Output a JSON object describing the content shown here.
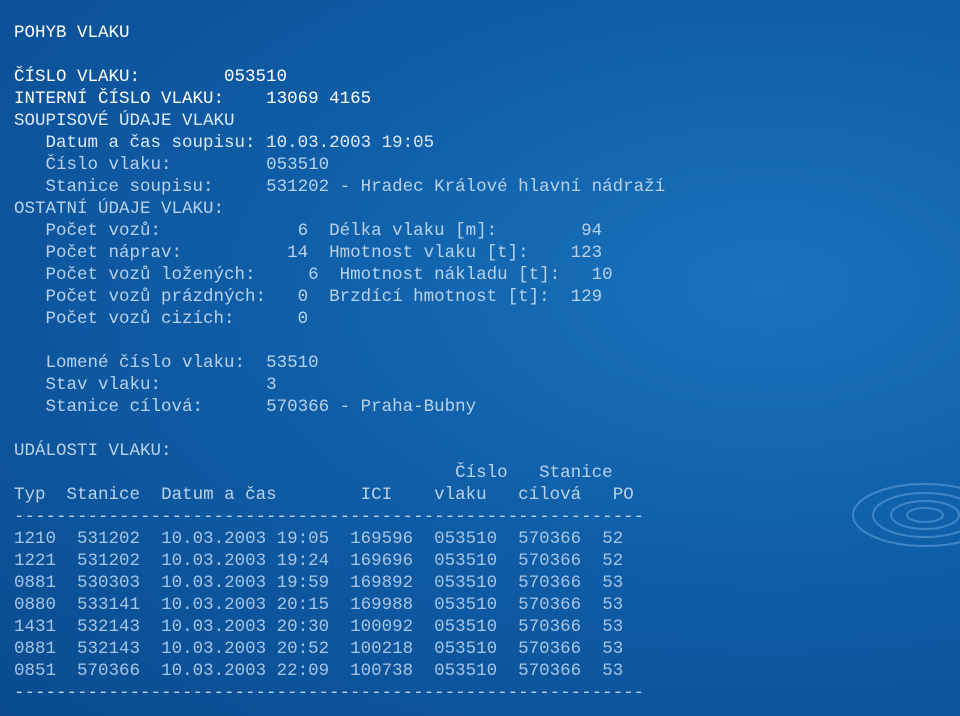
{
  "report": {
    "title": "POHYB VLAKU",
    "cislo_vlaku_label": "ČÍSLO VLAKU:",
    "cislo_vlaku": "053510",
    "interni_label": "INTERNÍ ČÍSLO VLAKU:",
    "interni": "13069 4165",
    "soupis_section": "SOUPISOVÉ ÚDAJE VLAKU",
    "datum_cas_label": "Datum a čas soupisu:",
    "datum_cas": "10.03.2003 19:05",
    "cislo_label": "Číslo vlaku:",
    "cislo": "053510",
    "stanice_soupisu_label": "Stanice soupisu:",
    "stanice_soupisu": "531202 - Hradec Králové hlavní nádraží",
    "ostatni_section": "OSTATNÍ ÚDAJE VLAKU:",
    "pocet_vozu_label": "Počet vozů:",
    "pocet_vozu": "6",
    "delka_label": "Délka vlaku [m]:",
    "delka": "94",
    "pocet_naprav_label": "Počet náprav:",
    "pocet_naprav": "14",
    "hmotnost_label": "Hmotnost vlaku [t]:",
    "hmotnost": "123",
    "lozenych_label": "Počet vozů ložených:",
    "lozenych": "6",
    "naklad_label": "Hmotnost nákladu [t]:",
    "naklad": "10",
    "prazdnych_label": "Počet vozů prázdných:",
    "prazdnych": "0",
    "brzdici_label": "Brzdící hmotnost [t]:",
    "brzdici": "129",
    "cizich_label": "Počet vozů cizích:",
    "cizich": "0",
    "lomene_label": "Lomené číslo vlaku:",
    "lomene": "53510",
    "stav_label": "Stav vlaku:",
    "stav": "3",
    "cilova_label": "Stanice cílová:",
    "cilova": "570366 - Praha-Bubny"
  },
  "events": {
    "title": "UDÁLOSTI VLAKU:",
    "header_top": {
      "cislo": "Číslo",
      "stanice": "Stanice"
    },
    "headers": {
      "typ": "Typ",
      "stanice": "Stanice",
      "datum": "Datum a čas",
      "ici": "ICI",
      "vlaku": "vlaku",
      "cilova": "cílová",
      "po": "PO"
    },
    "separator": "------------------------------------------------------------",
    "rows": [
      {
        "typ": "1210",
        "stanice": "531202",
        "datum": "10.03.2003 19:05",
        "ici": "169596",
        "vlak": "053510",
        "cil": "570366",
        "po": "52"
      },
      {
        "typ": "1221",
        "stanice": "531202",
        "datum": "10.03.2003 19:24",
        "ici": "169696",
        "vlak": "053510",
        "cil": "570366",
        "po": "52"
      },
      {
        "typ": "0881",
        "stanice": "530303",
        "datum": "10.03.2003 19:59",
        "ici": "169892",
        "vlak": "053510",
        "cil": "570366",
        "po": "53"
      },
      {
        "typ": "0880",
        "stanice": "533141",
        "datum": "10.03.2003 20:15",
        "ici": "169988",
        "vlak": "053510",
        "cil": "570366",
        "po": "53"
      },
      {
        "typ": "1431",
        "stanice": "532143",
        "datum": "10.03.2003 20:30",
        "ici": "100092",
        "vlak": "053510",
        "cil": "570366",
        "po": "53"
      },
      {
        "typ": "0881",
        "stanice": "532143",
        "datum": "10.03.2003 20:52",
        "ici": "100218",
        "vlak": "053510",
        "cil": "570366",
        "po": "53"
      },
      {
        "typ": "0851",
        "stanice": "570366",
        "datum": "10.03.2003 22:09",
        "ici": "100738",
        "vlak": "053510",
        "cil": "570366",
        "po": "53"
      }
    ]
  }
}
